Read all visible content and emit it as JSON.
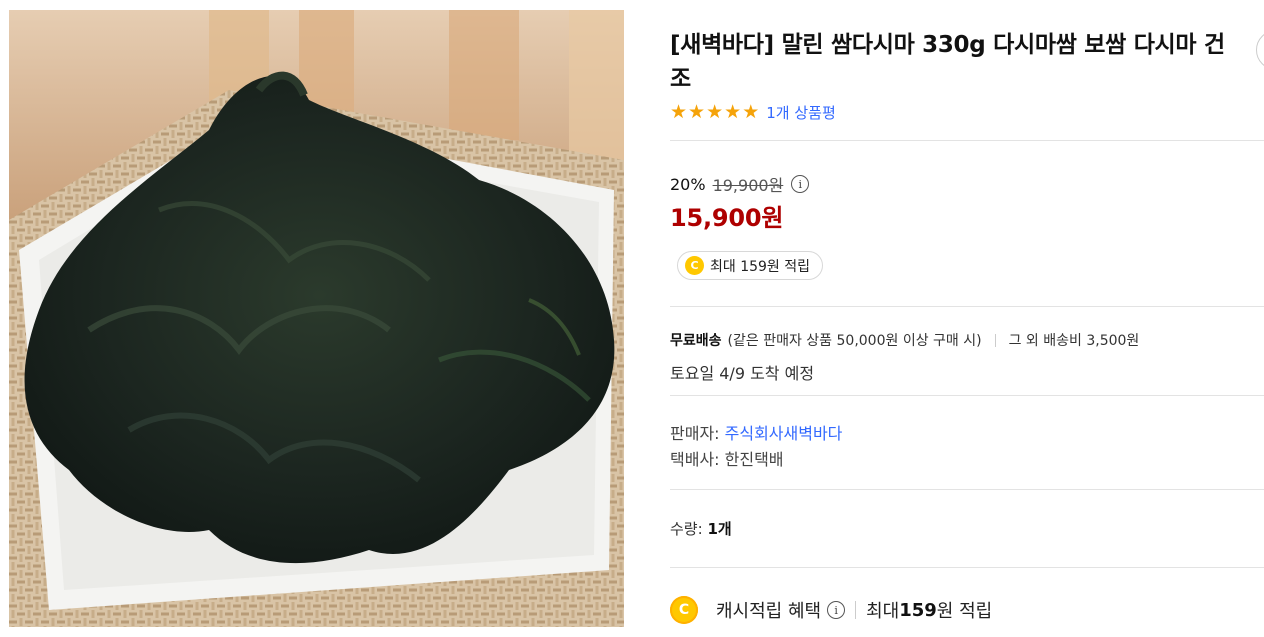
{
  "product": {
    "title": "[새벽바다] 말린 쌈다시마 330g 다시마쌈 보쌈 다시마 건조",
    "review_link": "1개 상품평",
    "stars": [
      "★",
      "★",
      "★",
      "★",
      "★"
    ]
  },
  "price": {
    "discount": "20%",
    "original": "19,900원",
    "info_glyph": "i",
    "sale": "15,900원"
  },
  "cash_badge": {
    "coin_letter": "C",
    "text": "최대 159원 적립"
  },
  "shipping": {
    "free_label": "무료배송",
    "condition": "(같은 판매자 상품 50,000원 이상 구매 시)",
    "other_fee": "그 외 배송비 3,500원",
    "arrival": "토요일 4/9 도착 예정"
  },
  "seller": {
    "seller_label": "판매자: ",
    "seller_name": "주식회사새벽바다",
    "courier_label": "택배사: ",
    "courier_name": "한진택배"
  },
  "quantity": {
    "label": "수량: ",
    "value": "1개"
  },
  "cash_benefit": {
    "coin_letter": "C",
    "label": "캐시적립 혜택",
    "info_glyph": "i",
    "prefix": "최대 ",
    "amount": "159",
    "suffix": "원 적립"
  },
  "colors": {
    "sale_price": "#ae0000",
    "link": "#346aff",
    "star": "#f5a30a",
    "coin": "#ffc800"
  }
}
